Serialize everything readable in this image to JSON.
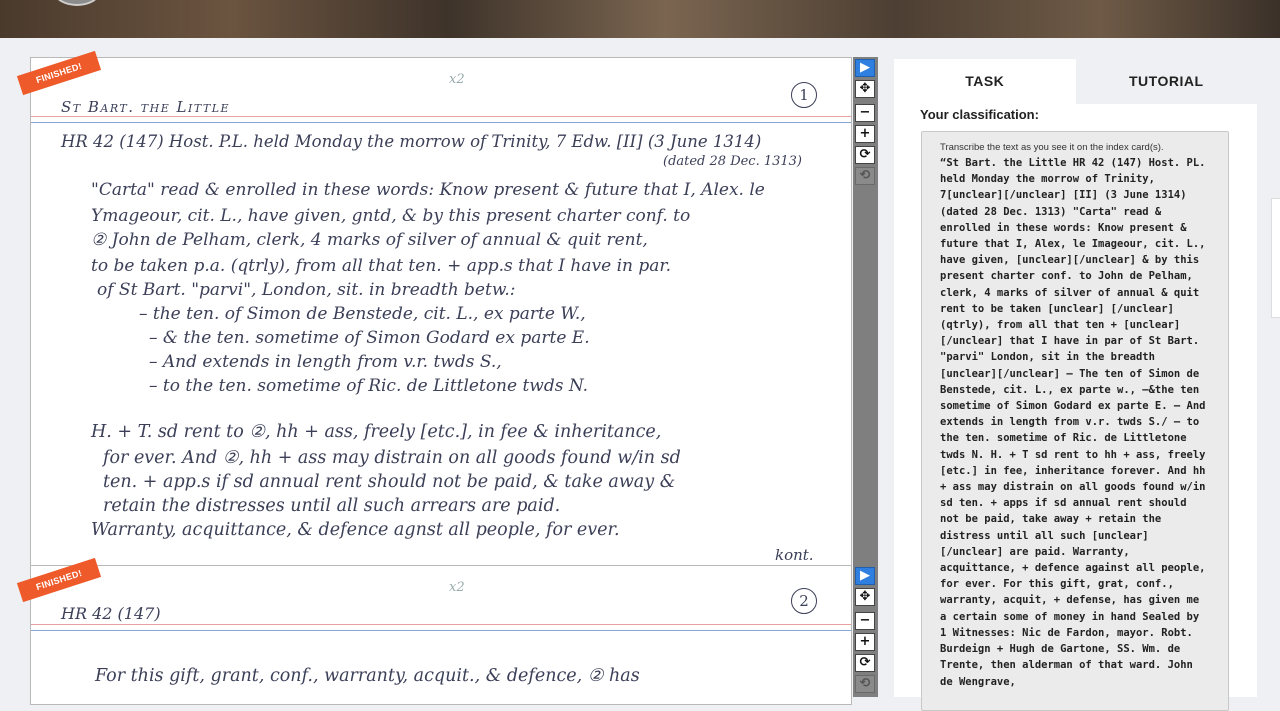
{
  "header": {
    "avatar": "user-avatar"
  },
  "cards": [
    {
      "status": "FINISHED!",
      "topmark": "x2",
      "page_num": "1",
      "lines": [
        "St Bart. the Little",
        "HR 42 (147)   Host. P.L. held Monday the morrow of Trinity, 7 Edw. [II] (3 June 1314)",
        "(dated 28 Dec. 1313)",
        "\"Carta\" read & enrolled in these words: Know present & future that I, Alex. le",
        "Ymageour, cit. L., have given, gntd, & by this present charter conf. to",
        "② John de Pelham, clerk, 4 marks of silver of annual & quit rent,",
        "to be taken p.a. (qtrly), from all that ten. + app.s that I have in par.",
        "of St Bart. \"parvi\", London, sit. in breadth betw.:",
        "– the ten. of Simon de Benstede, cit. L., ex parte W.,",
        "– & the ten. sometime of Simon Godard ex parte E.",
        "– And extends in length from v.r. twds S.,",
        "– to the ten. sometime of Ric. de Littletone twds N.",
        "H. + T.  sd rent to ②, hh + ass, freely [etc.], in fee & inheritance,",
        "for ever.  And ②, hh + ass may distrain on all goods found w/in sd",
        "ten. + app.s if sd annual rent should not be paid, & take away &",
        "retain the distresses until all such arrears are paid.",
        "Warranty, acquittance, & defence agnst all people, for ever.",
        "kont."
      ]
    },
    {
      "status": "FINISHED!",
      "topmark": "x2",
      "page_num": "2",
      "lines": [
        "HR 42 (147)",
        "For this gift, grant, conf., warranty, acquit., & defence, ② has"
      ]
    }
  ],
  "toolbar": {
    "select": "▶",
    "move": "✥",
    "zoom_out": "−",
    "zoom_in": "+",
    "reset": "⟳",
    "rotate": "⟲"
  },
  "panel": {
    "tabs": [
      "TASK",
      "TUTORIAL"
    ],
    "your_classification": "Your classification:",
    "instructions": "Transcribe the text as you see it on the index card(s).",
    "transcription": "“St Bart. the Little HR 42 (147) Host. PL. held Monday the morrow of Trinity, 7[unclear][/unclear] [II] (3 June 1314) (dated 28 Dec. 1313) \"Carta\" read & enrolled in these words: Know present & future that I, Alex, le Imageour, cit. L., have given, [unclear][/unclear] & by this present charter conf. to John de Pelham, clerk, 4 marks of silver of annual & quit rent to be taken [unclear] [/unclear] (qtrly), from all that ten + [unclear][/unclear] that I have in par of St Bart. \"parvi\" London, sit in the breadth [unclear][/unclear] – The ten of Simon de Benstede, cit. L., ex parte w., –&the ten sometime of Simon Godard ex parte E. – And extends in length from v.r. twds S./ – to the ten. sometime of Ric. de Littletone twds N. H. + T sd rent to hh + ass, freely [etc.] in fee, inheritance forever. And hh + ass may distrain on all goods found w/in sd ten. + apps if sd annual rent should not be paid, take away + retain the distress until all such [unclear][/unclear] are paid. Warranty, acquittance, + defence against all people, for ever. For this gift, grat, conf., warranty, acquit, + defense, has given me a certain some of money in hand Sealed by 1 Witnesses: Nic de Fardon, mayor. Robt. Burdeign + Hugh de Gartone, SS. Wm. de Trente, then alderman of that ward. John de Wengrave,"
  }
}
